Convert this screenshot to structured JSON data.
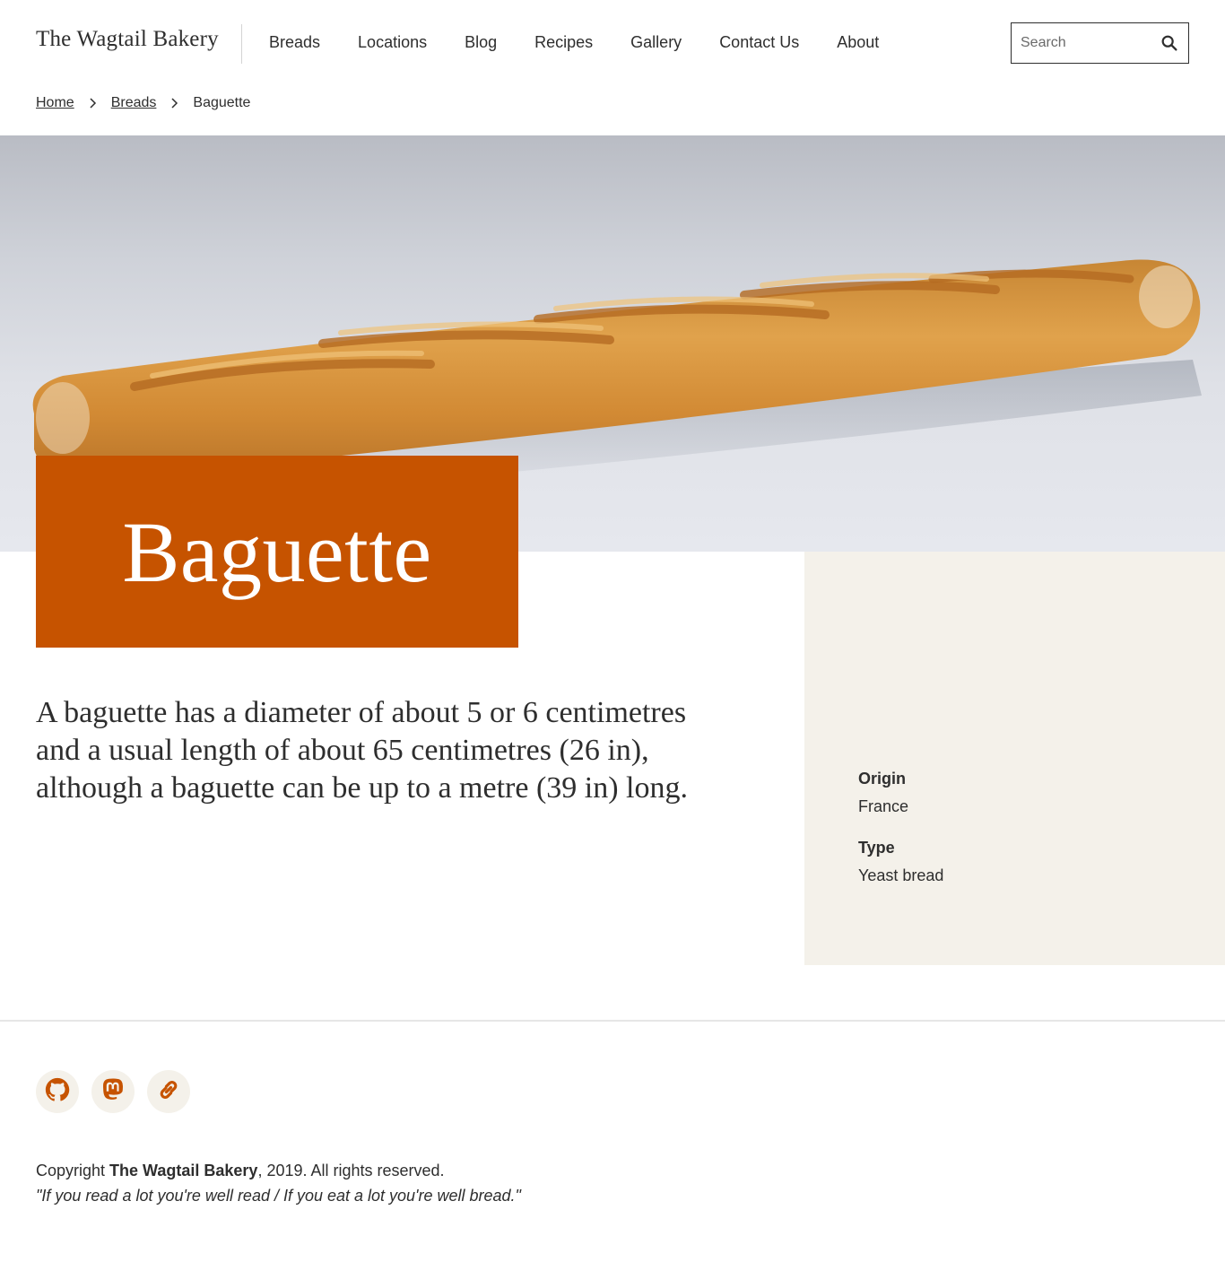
{
  "header": {
    "brand": "The Wagtail Bakery",
    "nav": [
      {
        "label": "Breads"
      },
      {
        "label": "Locations"
      },
      {
        "label": "Blog"
      },
      {
        "label": "Recipes"
      },
      {
        "label": "Gallery"
      },
      {
        "label": "Contact Us"
      },
      {
        "label": "About"
      }
    ],
    "search": {
      "placeholder": "Search",
      "value": ""
    }
  },
  "breadcrumb": {
    "items": [
      {
        "label": "Home"
      },
      {
        "label": "Breads"
      }
    ],
    "current": "Baguette"
  },
  "hero": {
    "image": "baguette-photo"
  },
  "page": {
    "title": "Baguette",
    "intro": "A baguette has a diameter of about 5 or 6 centimetres and a usual length of about 65 centimetres (26 in), although a baguette can be up to a metre (39 in) long."
  },
  "details": [
    {
      "label": "Origin",
      "value": "France"
    },
    {
      "label": "Type",
      "value": "Yeast bread"
    }
  ],
  "footer": {
    "socials": [
      {
        "icon": "github-icon"
      },
      {
        "icon": "mastodon-icon"
      },
      {
        "icon": "link-icon"
      }
    ],
    "copyright_prefix": "Copyright ",
    "copyright_owner": "The Wagtail Bakery",
    "copyright_suffix": ", 2019. All rights reserved.",
    "tagline": "\"If you read a lot you're well read / If you eat a lot you're well bread.\""
  },
  "colors": {
    "accent": "#c65300",
    "aside_bg": "#f4f1ea",
    "text": "#2e2e2e"
  }
}
